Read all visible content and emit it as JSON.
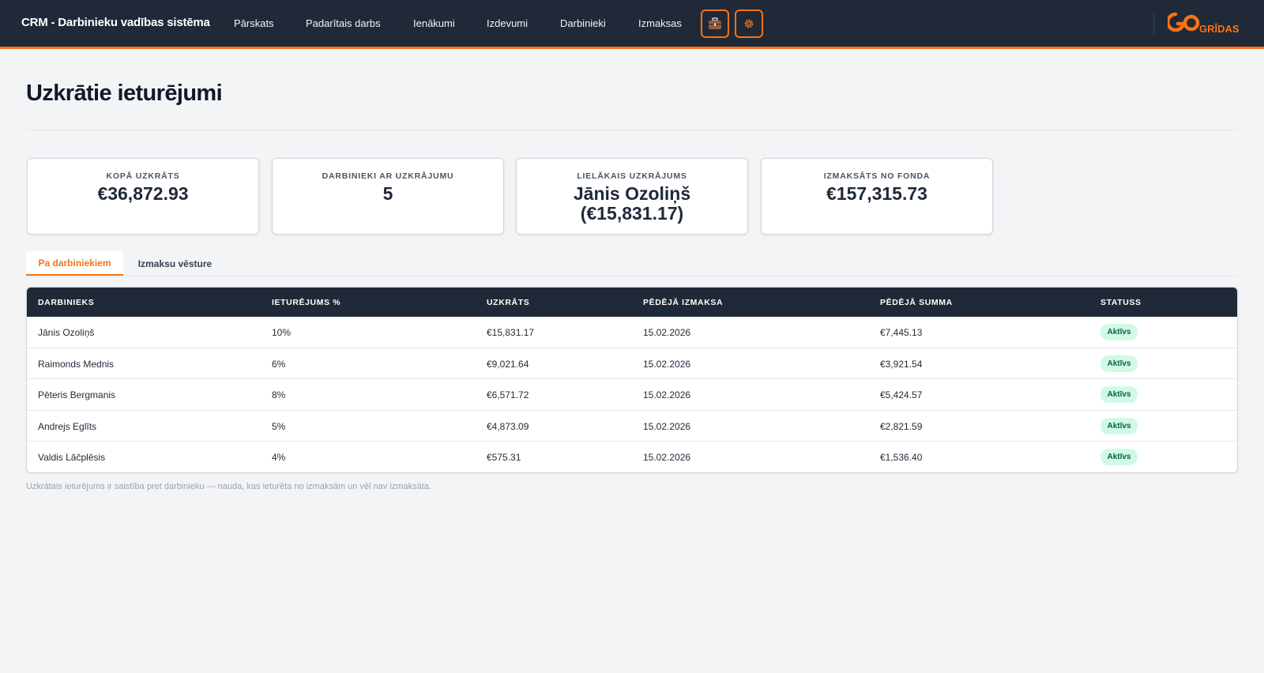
{
  "header": {
    "brand": "CRM - Darbinieku vadības sistēma",
    "nav": [
      "Pārskats",
      "Padarītais darbs",
      "Ienākumi",
      "Izdevumi",
      "Darbinieki",
      "Izmaksas"
    ],
    "icon_buttons": [
      "briefcase-icon",
      "gear-icon"
    ],
    "logo_text": "GRĪDAS",
    "accent": "#f97316"
  },
  "page": {
    "title": "Uzkrātie ieturējumi",
    "note": "Uzkrātais ieturējums ir saistība pret darbinieku — nauda, kas ieturēta no izmaksām un vēl nav izmaksāta."
  },
  "stats": [
    {
      "label": "KOPĀ UZKRĀTS",
      "value": "€36,872.93"
    },
    {
      "label": "DARBINIEKI AR UZKRĀJUMU",
      "value": "5"
    },
    {
      "label": "LIELĀKAIS UZKRĀJUMS",
      "value": "Jānis Ozoliņš (€15,831.17)"
    },
    {
      "label": "IZMAKSĀTS NO FONDA",
      "value": "€157,315.73"
    }
  ],
  "tabs": [
    {
      "label": "Pa darbiniekiem",
      "active": true
    },
    {
      "label": "Izmaksu vēsture",
      "active": false
    }
  ],
  "table": {
    "columns": [
      "DARBINIEKS",
      "IETURĒJUMS %",
      "UZKRĀTS",
      "PĒDĒJĀ IZMAKSA",
      "PĒDĒJĀ SUMMA",
      "STATUSS"
    ],
    "rows": [
      [
        "Jānis Ozoliņš",
        "10%",
        "€15,831.17",
        "15.02.2026",
        "€7,445.13",
        "Aktīvs"
      ],
      [
        "Raimonds Mednis",
        "6%",
        "€9,021.64",
        "15.02.2026",
        "€3,921.54",
        "Aktīvs"
      ],
      [
        "Pēteris Bergmanis",
        "8%",
        "€6,571.72",
        "15.02.2026",
        "€5,424.57",
        "Aktīvs"
      ],
      [
        "Andrejs Eglīts",
        "5%",
        "€4,873.09",
        "15.02.2026",
        "€2,821.59",
        "Aktīvs"
      ],
      [
        "Valdis Lāčplēsis",
        "4%",
        "€575.31",
        "15.02.2026",
        "€1,536.40",
        "Aktīvs"
      ]
    ]
  }
}
